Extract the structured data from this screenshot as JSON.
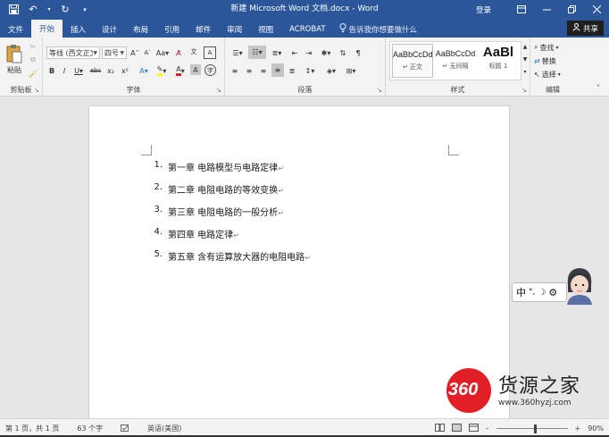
{
  "window": {
    "title": "新建 Microsoft Word 文档.docx - Word",
    "signin": "登录",
    "share": "共享"
  },
  "tabs": [
    {
      "label": "文件",
      "active": false
    },
    {
      "label": "开始",
      "active": true
    },
    {
      "label": "插入",
      "active": false
    },
    {
      "label": "设计",
      "active": false
    },
    {
      "label": "布局",
      "active": false
    },
    {
      "label": "引用",
      "active": false
    },
    {
      "label": "邮件",
      "active": false
    },
    {
      "label": "审阅",
      "active": false
    },
    {
      "label": "视图",
      "active": false
    },
    {
      "label": "ACROBAT",
      "active": false
    }
  ],
  "tellme": "告诉我你想要做什么",
  "ribbon": {
    "clipboard": {
      "label": "剪贴板",
      "paste": "粘贴"
    },
    "font": {
      "label": "字体",
      "font_name": "等线 (西文正文)",
      "font_size": "四号",
      "strike": "abc",
      "subscript": "x₂",
      "superscript": "x²"
    },
    "paragraph": {
      "label": "段落"
    },
    "styles": {
      "label": "样式",
      "items": [
        {
          "preview": "AaBbCcDd",
          "name": "正文"
        },
        {
          "preview": "AaBbCcDd",
          "name": "无间隔"
        },
        {
          "preview": "AaBl",
          "name": "标题 1"
        }
      ]
    },
    "editing": {
      "label": "编辑",
      "find": "查找",
      "replace": "替换",
      "select": "选择"
    }
  },
  "document": {
    "items": [
      {
        "num": "1.",
        "text": "第一章  电路模型与电路定律"
      },
      {
        "num": "2.",
        "text": "第二章  电阻电路的等效变换"
      },
      {
        "num": "3.",
        "text": "第三章  电阻电路的一般分析"
      },
      {
        "num": "4.",
        "text": "第四章  电路定律"
      },
      {
        "num": "5.",
        "text": "第五章  含有运算放大器的电阻电路"
      }
    ],
    "paragraph_mark": "↵"
  },
  "ime": {
    "mode": "中",
    "punct": "°,",
    "moon": "☽",
    "gear": "⚙"
  },
  "watermark": {
    "badge": "360",
    "name": "货源之家",
    "url": "www.360hyzj.com"
  },
  "status": {
    "page": "第 1 页，共 1 页",
    "words": "63 个字",
    "language": "英语(美国)",
    "zoom": "90%",
    "zoom_level": 0.55
  }
}
